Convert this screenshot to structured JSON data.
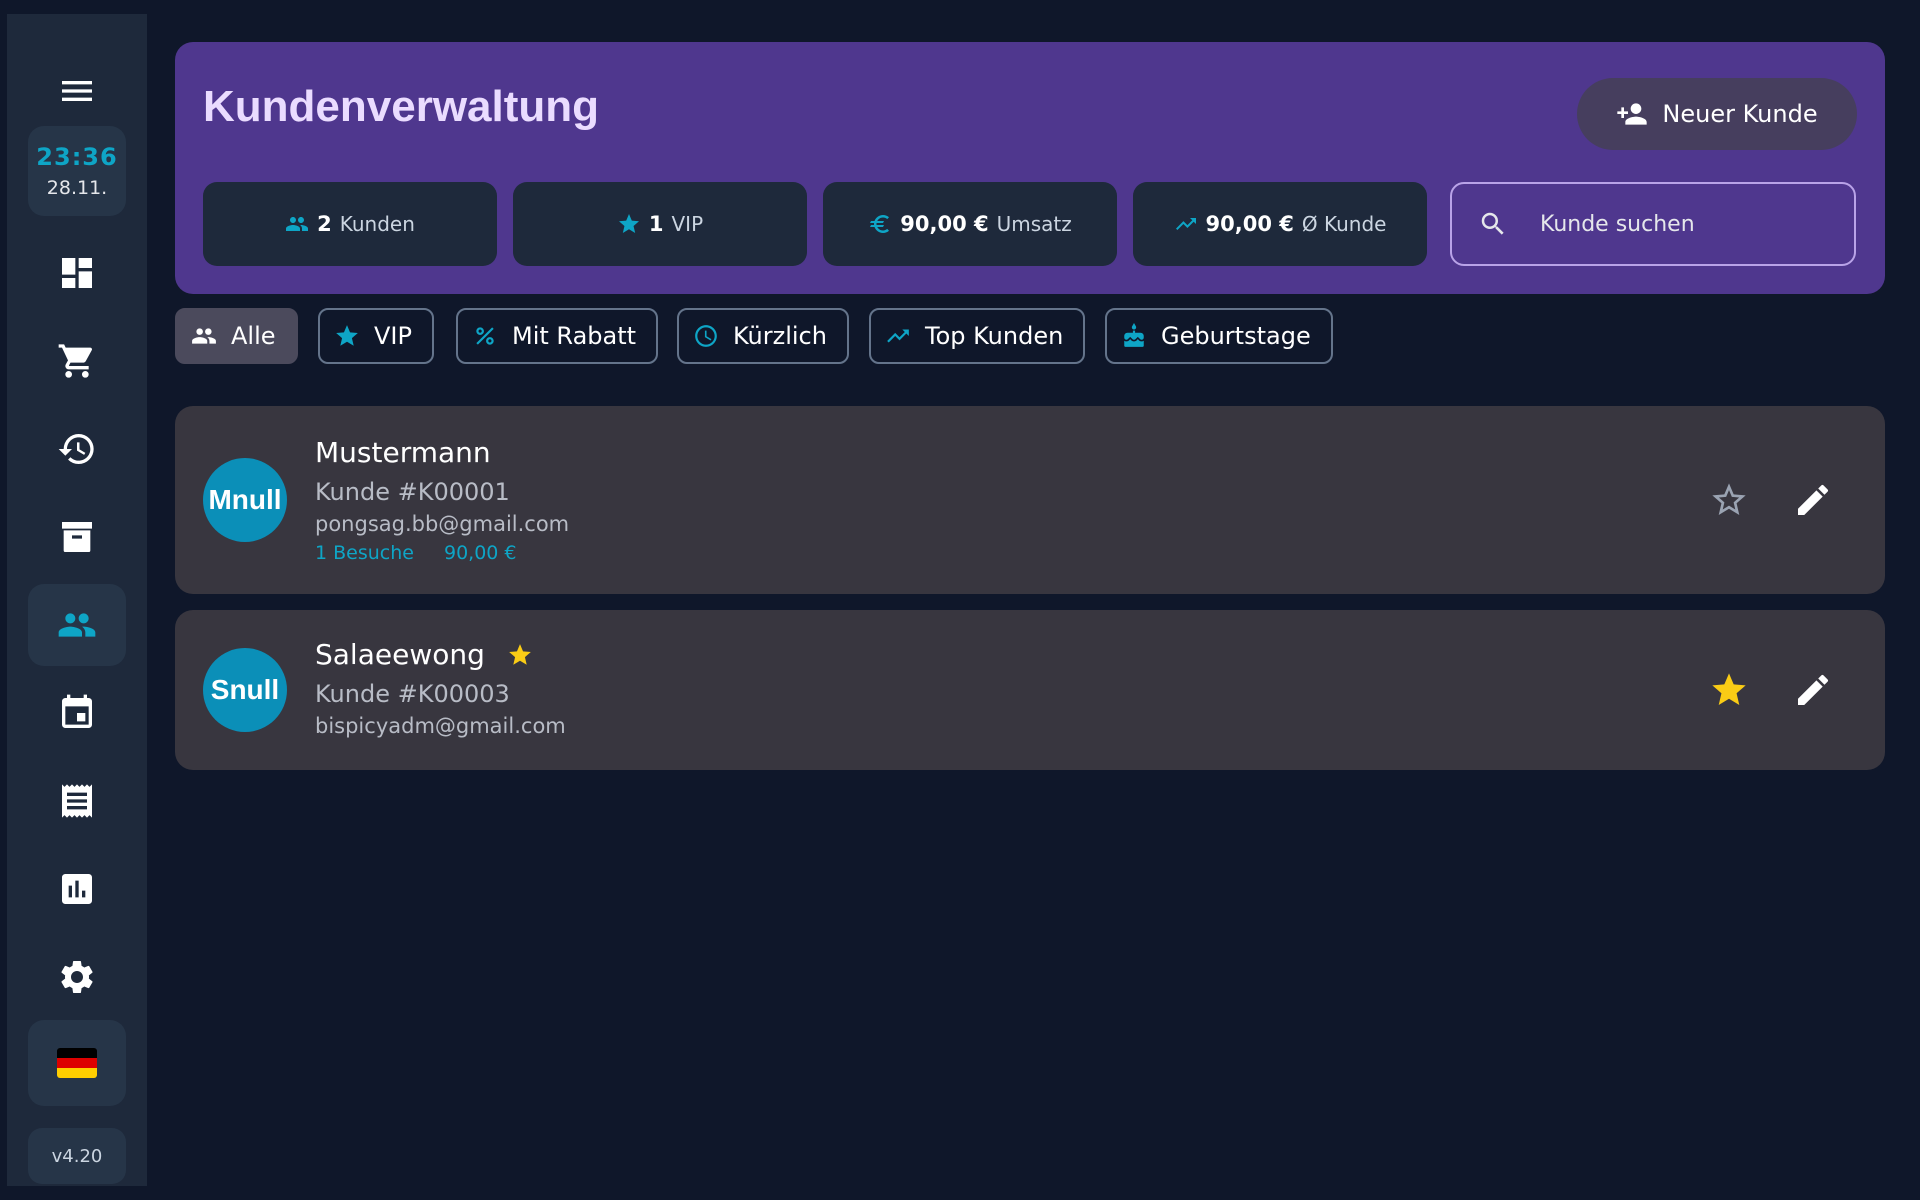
{
  "sidebar": {
    "time": "23:36",
    "date": "28.11.",
    "version": "v4.20",
    "items": [
      {
        "name": "menu-icon"
      },
      {
        "name": "dashboard-icon"
      },
      {
        "name": "cart-icon"
      },
      {
        "name": "history-icon"
      },
      {
        "name": "archive-icon"
      },
      {
        "name": "customers-icon",
        "active": true
      },
      {
        "name": "calendar-icon"
      },
      {
        "name": "receipt-icon"
      },
      {
        "name": "reports-icon"
      },
      {
        "name": "settings-icon"
      }
    ],
    "language_flag": "de-flag-icon"
  },
  "header": {
    "title": "Kundenverwaltung",
    "new_customer_label": "Neuer Kunde",
    "stats": [
      {
        "icon": "people-icon",
        "value": "2",
        "label": "Kunden"
      },
      {
        "icon": "star-icon",
        "value": "1",
        "label": "VIP"
      },
      {
        "icon": "euro-icon",
        "value": "90,00 €",
        "label": "Umsatz"
      },
      {
        "icon": "trending-up-icon",
        "value": "90,00 €",
        "label": "Ø Kunde"
      }
    ],
    "search_placeholder": "Kunde suchen"
  },
  "filters": [
    {
      "label": "Alle",
      "icon": "people-icon",
      "active": true
    },
    {
      "label": "VIP",
      "icon": "star-icon"
    },
    {
      "label": "Mit Rabatt",
      "icon": "percent-icon"
    },
    {
      "label": "Kürzlich",
      "icon": "clock-icon"
    },
    {
      "label": "Top Kunden",
      "icon": "trending-up-icon"
    },
    {
      "label": "Geburtstage",
      "icon": "cake-icon"
    }
  ],
  "customers": [
    {
      "initials": "Mnull",
      "name": "Mustermann",
      "customer_no": "Kunde #K00001",
      "email": "pongsag.bb@gmail.com",
      "visits": "1 Besuche",
      "revenue": "90,00 €",
      "vip": false
    },
    {
      "initials": "Snull",
      "name": "Salaeewong",
      "customer_no": "Kunde #K00003",
      "email": "bispicyadm@gmail.com",
      "vip": true
    }
  ],
  "colors": {
    "background": "#0f172a",
    "sidebar": "#1e293b",
    "header": "#4f378e",
    "accent": "#0ea5c6",
    "card": "#38363f",
    "vip_star": "#facc15"
  }
}
